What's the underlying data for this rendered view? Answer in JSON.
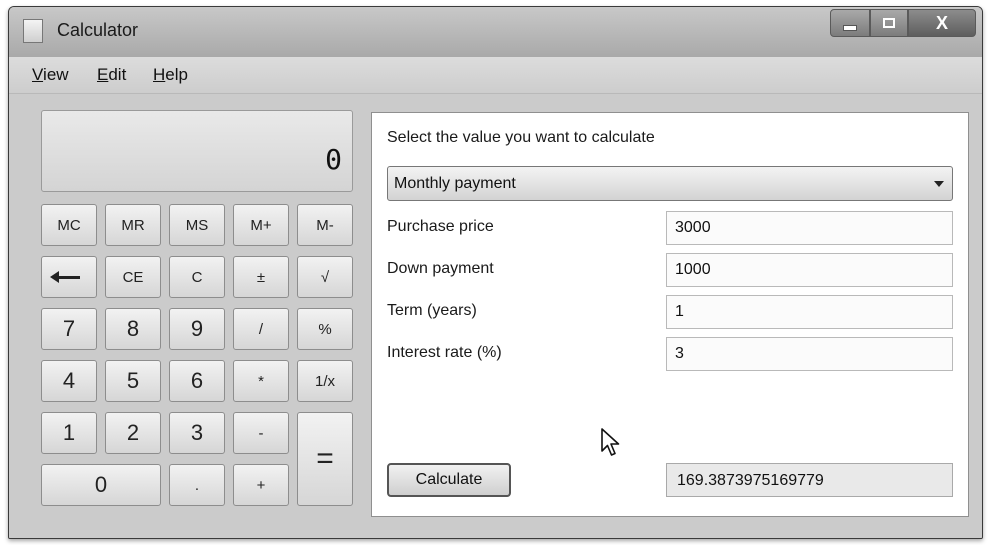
{
  "window": {
    "title": "Calculator",
    "icon": "calculator-app-icon",
    "controls": {
      "minimize": "minimize-icon",
      "maximize": "maximize-icon",
      "close_label": "X"
    }
  },
  "menu": {
    "items": [
      {
        "label_accel": "V",
        "label_rest": "iew"
      },
      {
        "label_accel": "E",
        "label_rest": "dit"
      },
      {
        "label_accel": "H",
        "label_rest": "elp"
      }
    ]
  },
  "display": {
    "value": "0"
  },
  "keypad": {
    "memory": [
      "MC",
      "MR",
      "MS",
      "M+",
      "M-"
    ],
    "row2": {
      "backspace_icon": "backspace-arrow-icon",
      "ce": "CE",
      "c": "C",
      "plus_minus": "±",
      "sqrt": "√"
    },
    "row3": [
      "7",
      "8",
      "9",
      "/",
      "%"
    ],
    "row4": [
      "4",
      "5",
      "6",
      "*",
      "1/x"
    ],
    "row5": [
      "1",
      "2",
      "3",
      "-"
    ],
    "row6": {
      "zero": "0",
      "dot": ".",
      "plus": "+"
    },
    "equals": "="
  },
  "worksheet": {
    "prompt": "Select the value you want to calculate",
    "mode_select": "Monthly payment",
    "fields": [
      {
        "label": "Purchase price",
        "value": "3000"
      },
      {
        "label": "Down payment",
        "value": "1000"
      },
      {
        "label": "Term (years)",
        "value": "1"
      },
      {
        "label": "Interest rate (%)",
        "value": "3"
      }
    ],
    "calculate_label": "Calculate",
    "result": "169.3873975169779"
  },
  "cursor": {
    "icon": "mouse-pointer-icon"
  }
}
